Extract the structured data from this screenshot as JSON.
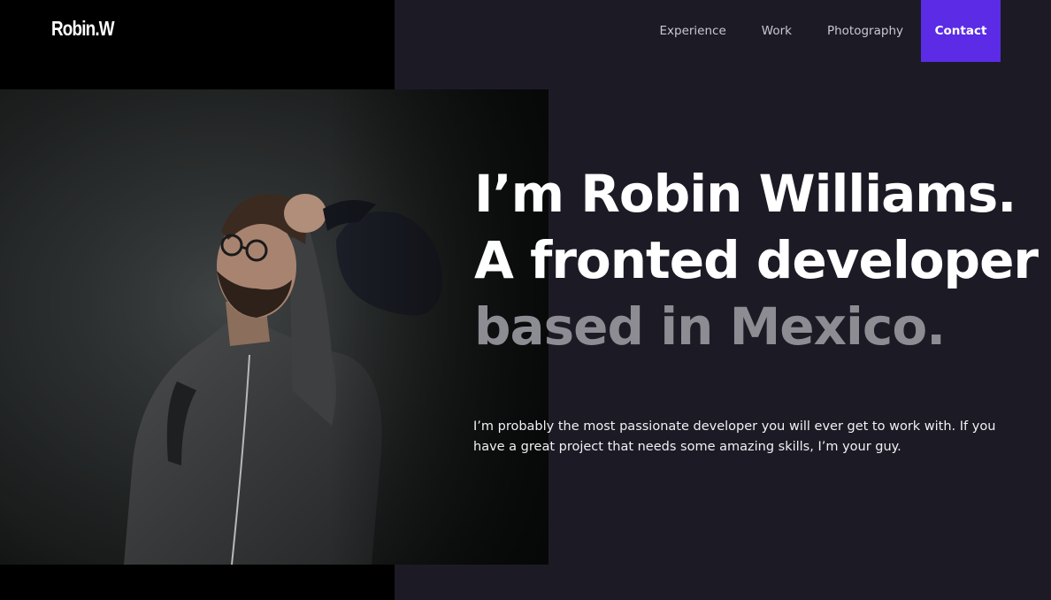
{
  "brand": {
    "logo_text": "Robin.W"
  },
  "nav": {
    "items": [
      {
        "label": "Experience"
      },
      {
        "label": "Work"
      },
      {
        "label": "Photography"
      }
    ],
    "contact_label": "Contact"
  },
  "hero": {
    "headline_line1": "I’m Robin Williams.",
    "headline_line2": "A fronted developer",
    "headline_line3": "based in Mexico.",
    "intro": "I’m probably the most passionate developer you will ever get to work with. If you have a great project that needs some amazing skills, I’m your guy.",
    "photo_subject": "man-in-grey-hoodie-holding-cap-portrait"
  },
  "colors": {
    "page_background": "#1c1b25",
    "left_panel": "#000000",
    "accent": "#5b2be6",
    "headline_primary": "#ffffff",
    "headline_muted": "#8d8c93",
    "nav_text": "#c9c8d2"
  }
}
